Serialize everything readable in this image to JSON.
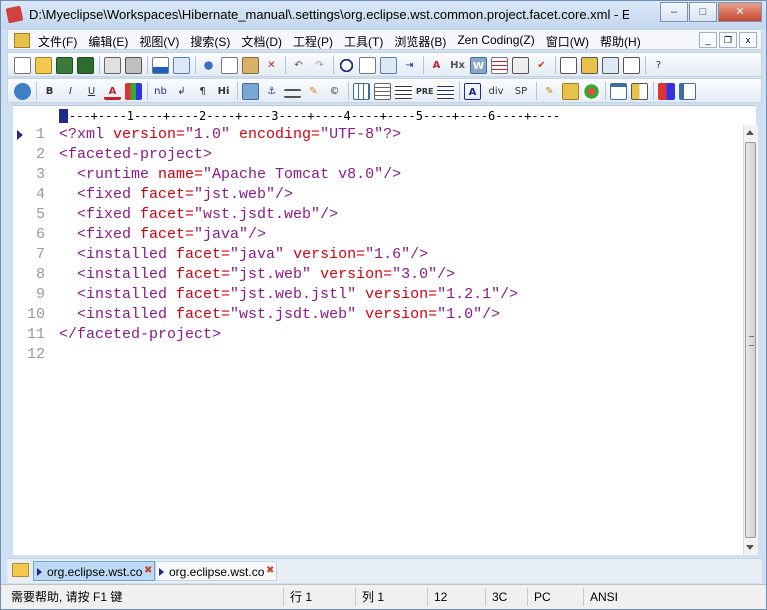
{
  "window": {
    "title": "D:\\Myeclipse\\Workspaces\\Hibernate_manual\\.settings\\org.eclipse.wst.common.project.facet.core.xml - Edit...",
    "controls": {
      "minimize": "–",
      "maximize": "□",
      "close": "✕"
    }
  },
  "menubar": {
    "items": [
      "文件(F)",
      "编辑(E)",
      "视图(V)",
      "搜索(S)",
      "文档(D)",
      "工程(P)",
      "工具(T)",
      "浏览器(B)",
      "Zen Coding(Z)",
      "窗口(W)",
      "帮助(H)"
    ],
    "mdi_controls": {
      "minimize": "_",
      "restore": "❐",
      "close": "x"
    }
  },
  "toolbar1": {
    "icons": [
      "new-file-icon",
      "open-folder-icon",
      "save-icon",
      "save-all-icon",
      "print-preview-icon",
      "print-icon",
      "spellcheck-icon",
      "sync-icon",
      "cut-icon",
      "copy-icon",
      "paste-icon",
      "delete-icon",
      "undo-icon",
      "redo-icon",
      "find-icon",
      "replace-icon",
      "find-in-files-icon",
      "goto-icon",
      "font-size-icon",
      "heading-icon",
      "word-wrap-icon",
      "list-icon",
      "column-mode-icon",
      "check-icon",
      "view1-icon",
      "view2-icon",
      "view3-icon",
      "view4-icon",
      "help-pointer-icon"
    ]
  },
  "toolbar2": {
    "labels": {
      "bold": "B",
      "italic": "I",
      "underline": "U",
      "font_color": "A",
      "nb": "nb",
      "br": "↲",
      "para": "¶",
      "hi": "Hi",
      "pre": "PRE",
      "div": "div",
      "sp": "SP",
      "copyright": "©"
    }
  },
  "ruler": {
    "text": "---+----1----+----2----+----3----+----4----+----5----+----6----+----"
  },
  "editor": {
    "lines": [
      {
        "n": "1",
        "parts": [
          [
            "tag",
            "<?xml "
          ],
          [
            "attr",
            "version="
          ],
          [
            "val",
            "\"1.0\""
          ],
          [
            "attr",
            " encoding="
          ],
          [
            "val",
            "\"UTF-8\""
          ],
          [
            "tag",
            "?>"
          ]
        ]
      },
      {
        "n": "2",
        "parts": [
          [
            "tag",
            "<faceted-project>"
          ]
        ]
      },
      {
        "n": "3",
        "parts": [
          [
            "tag",
            "  <runtime "
          ],
          [
            "attr",
            "name="
          ],
          [
            "val",
            "\"Apache Tomcat v8.0\""
          ],
          [
            "tag",
            "/>"
          ]
        ]
      },
      {
        "n": "4",
        "parts": [
          [
            "tag",
            "  <fixed "
          ],
          [
            "attr",
            "facet="
          ],
          [
            "val",
            "\"jst.web\""
          ],
          [
            "tag",
            "/>"
          ]
        ]
      },
      {
        "n": "5",
        "parts": [
          [
            "tag",
            "  <fixed "
          ],
          [
            "attr",
            "facet="
          ],
          [
            "val",
            "\"wst.jsdt.web\""
          ],
          [
            "tag",
            "/>"
          ]
        ]
      },
      {
        "n": "6",
        "parts": [
          [
            "tag",
            "  <fixed "
          ],
          [
            "attr",
            "facet="
          ],
          [
            "val",
            "\"java\""
          ],
          [
            "tag",
            "/>"
          ]
        ]
      },
      {
        "n": "7",
        "parts": [
          [
            "tag",
            "  <installed "
          ],
          [
            "attr",
            "facet="
          ],
          [
            "val",
            "\"java\""
          ],
          [
            "attr",
            " version="
          ],
          [
            "val",
            "\"1.6\""
          ],
          [
            "tag",
            "/>"
          ]
        ]
      },
      {
        "n": "8",
        "parts": [
          [
            "tag",
            "  <installed "
          ],
          [
            "attr",
            "facet="
          ],
          [
            "val",
            "\"jst.web\""
          ],
          [
            "attr",
            " version="
          ],
          [
            "val",
            "\"3.0\""
          ],
          [
            "tag",
            "/>"
          ]
        ]
      },
      {
        "n": "9",
        "parts": [
          [
            "tag",
            "  <installed "
          ],
          [
            "attr",
            "facet="
          ],
          [
            "val",
            "\"jst.web.jstl\""
          ],
          [
            "attr",
            " version="
          ],
          [
            "val",
            "\"1.2.1\""
          ],
          [
            "tag",
            "/>"
          ]
        ]
      },
      {
        "n": "10",
        "parts": [
          [
            "tag",
            "  <installed "
          ],
          [
            "attr",
            "facet="
          ],
          [
            "val",
            "\"wst.jsdt.web\""
          ],
          [
            "attr",
            " version="
          ],
          [
            "val",
            "\"1.0\""
          ],
          [
            "tag",
            "/>"
          ]
        ]
      },
      {
        "n": "11",
        "parts": [
          [
            "tag",
            "</faceted-project>"
          ]
        ]
      },
      {
        "n": "12",
        "parts": []
      }
    ]
  },
  "tabs": [
    {
      "label": "org.eclipse.wst.co",
      "active": true
    },
    {
      "label": "org.eclipse.wst.co",
      "active": false
    }
  ],
  "status": {
    "help": "需要帮助, 请按 F1 键",
    "row": "行 1",
    "col": "列 1",
    "count": "12",
    "char": "3C",
    "line_ending": "PC",
    "encoding": "ANSI"
  },
  "colors": {
    "tag": "#8a1a8a",
    "attribute": "#d4000f",
    "value": "#8a1a8a",
    "line_number": "#9a9a9a"
  }
}
